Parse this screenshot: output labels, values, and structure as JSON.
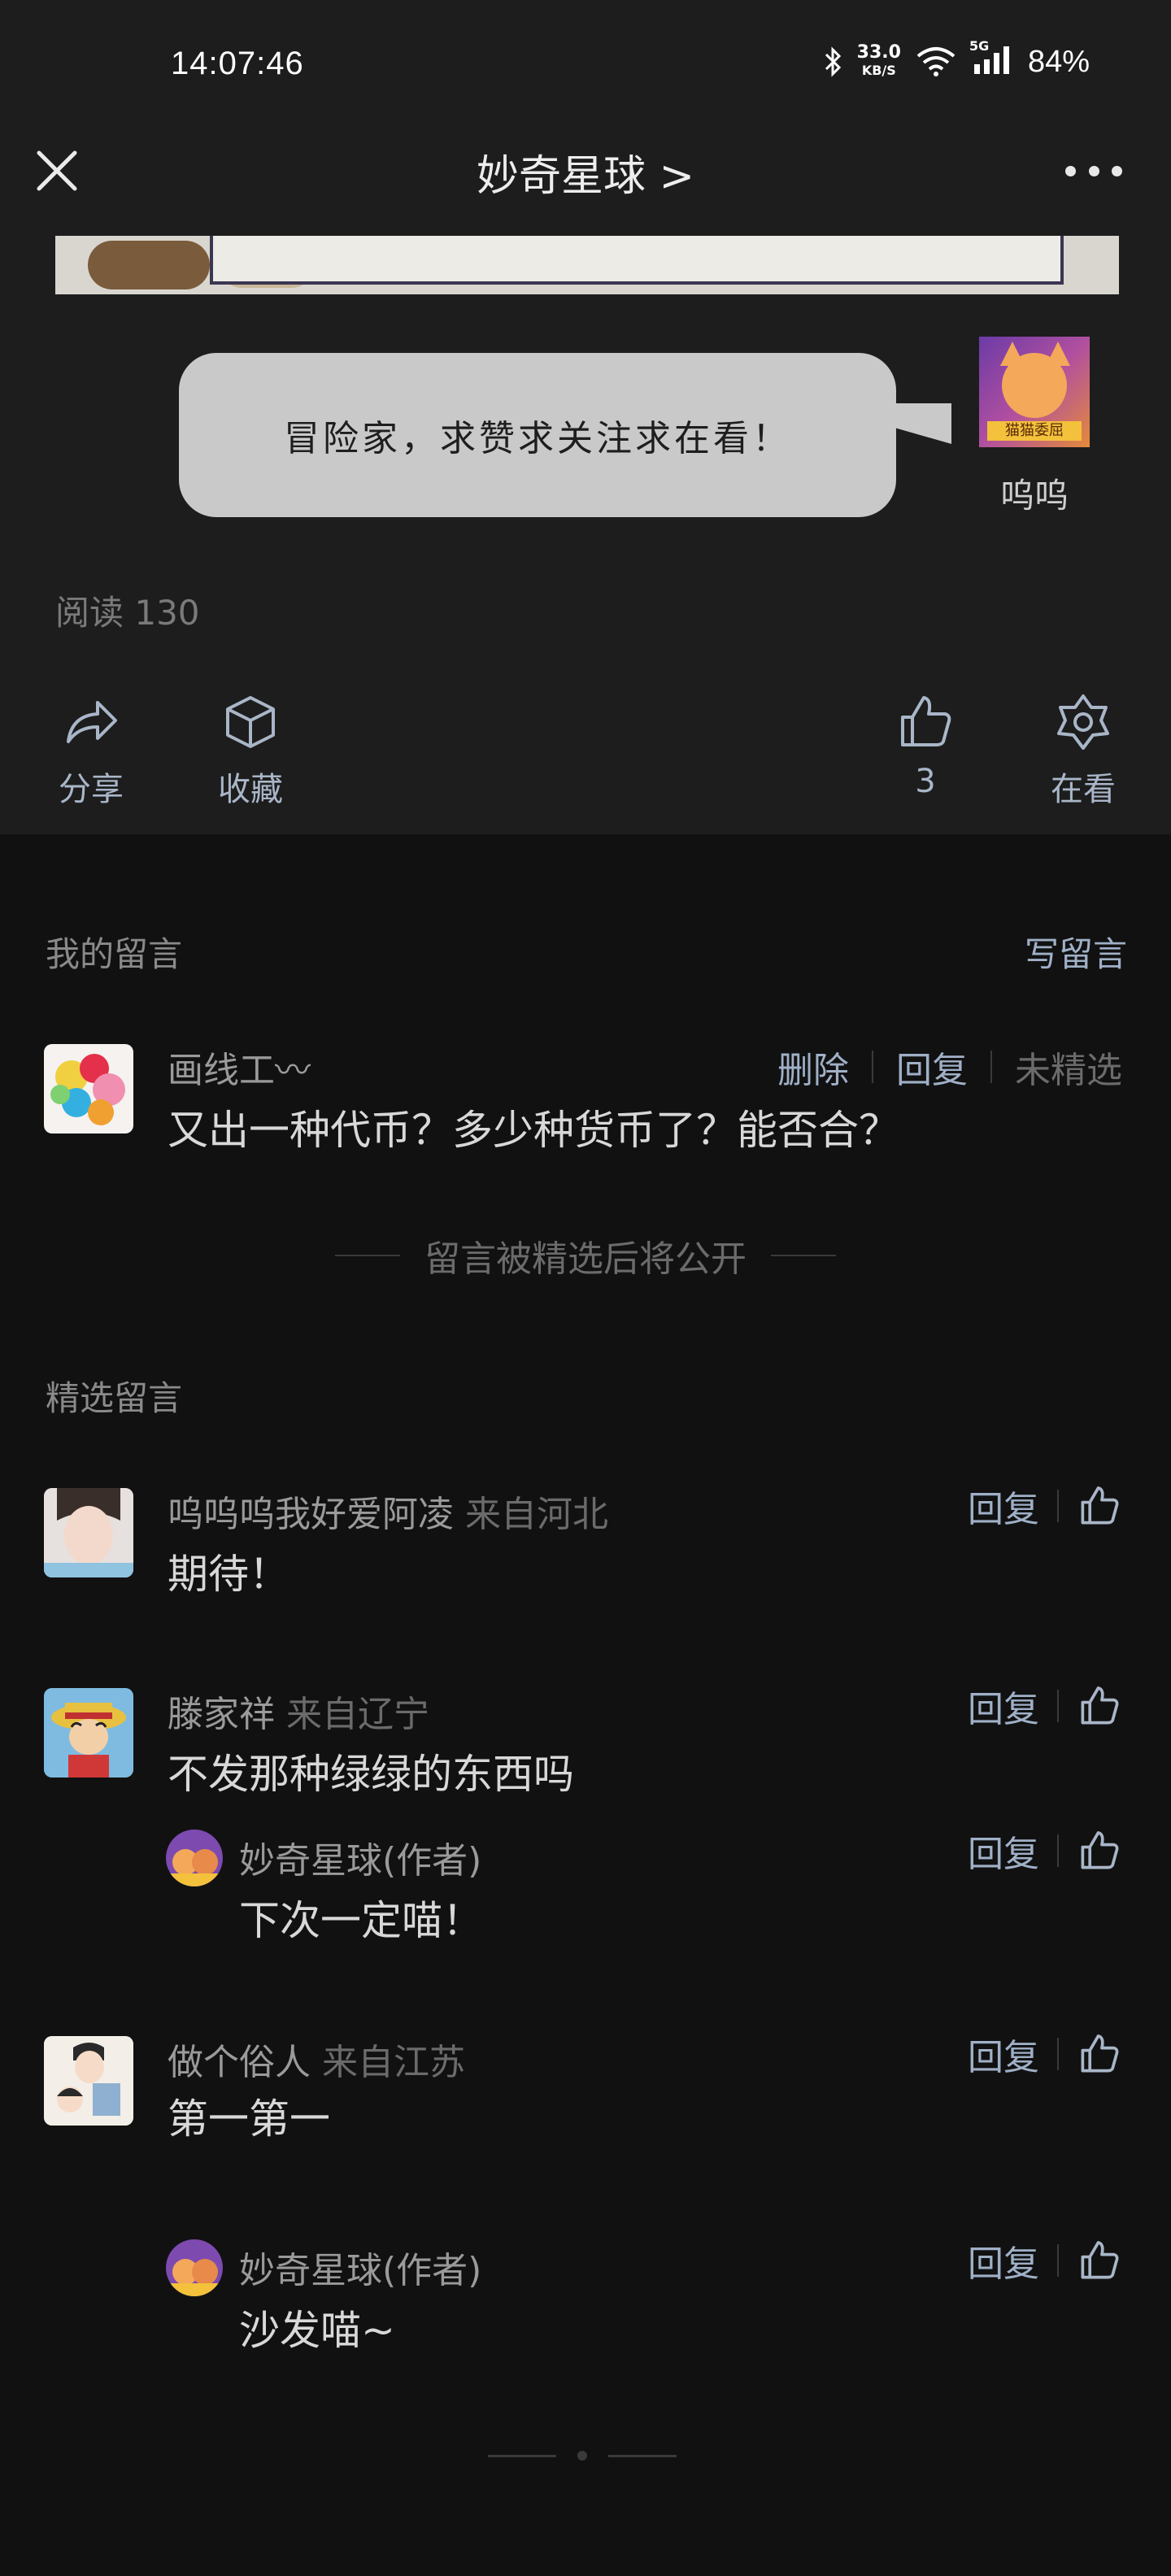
{
  "status_bar": {
    "time": "14:07:46",
    "net_speed_value": "33.0",
    "net_speed_unit": "KB/S",
    "network_type": "5G",
    "battery": "84%"
  },
  "nav": {
    "title": "妙奇星球 >"
  },
  "article": {
    "bubble_text": "冒险家，求赞求关注求在看！",
    "speaker_name": "呜呜",
    "avatar_tag": "猫猫委屈",
    "read_count": "阅读 130",
    "actions": {
      "share": "分享",
      "collect": "收藏",
      "like_count": "3",
      "watching": "在看"
    }
  },
  "my_comments": {
    "title": "我的留言",
    "write_label": "写留言",
    "item": {
      "nickname": "画线工〰",
      "text": "又出一种代币？多少种货币了？能否合？",
      "delete_label": "删除",
      "reply_label": "回复",
      "status": "未精选"
    },
    "note": "留言被精选后将公开"
  },
  "featured": {
    "title": "精选留言",
    "comments": [
      {
        "nickname": "呜呜呜我好爱阿凌",
        "location": "来自河北",
        "text": "期待！",
        "reply_label": "回复"
      },
      {
        "nickname": "滕家祥",
        "location": "来自辽宁",
        "text": "不发那种绿绿的东西吗",
        "reply_label": "回复",
        "author_reply": {
          "nickname": "妙奇星球(作者)",
          "text": "下次一定喵！",
          "reply_label": "回复"
        }
      },
      {
        "nickname": "做个俗人",
        "location": "来自江苏",
        "text": "第一第一",
        "reply_label": "回复",
        "author_reply": {
          "nickname": "妙奇星球(作者)",
          "text": "沙发喵~",
          "reply_label": "回复"
        }
      }
    ]
  },
  "colors": {
    "background": "#111111",
    "header_bg": "#1d1d1d",
    "link_blue": "#9fb0c7",
    "bubble_gray": "#c9c9c9"
  }
}
